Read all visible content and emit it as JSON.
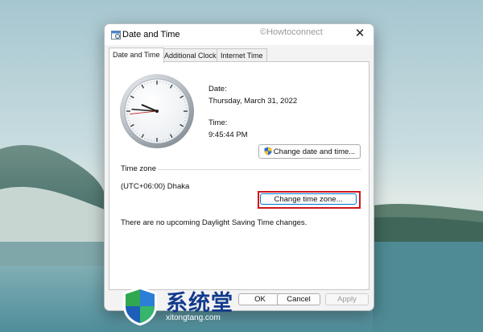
{
  "window": {
    "title": "Date and Time",
    "close_glyph": "✕",
    "watermark": "©Howtoconnect"
  },
  "tabs": [
    {
      "label": "Date and Time",
      "active": true
    },
    {
      "label": "Additional Clocks",
      "active": false
    },
    {
      "label": "Internet Time",
      "active": false
    }
  ],
  "clock": {
    "hours": 9,
    "minutes": 45,
    "seconds": 44,
    "hand_color": "#1e1e1e",
    "second_hand_color": "#c21a1a"
  },
  "date_section": {
    "date_label": "Date:",
    "date_value": "Thursday, March 31, 2022",
    "time_label": "Time:",
    "time_value": "9:45:44 PM",
    "change_button": "Change date and time..."
  },
  "timezone_section": {
    "heading": "Time zone",
    "value": "(UTC+06:00) Dhaka",
    "change_button": "Change time zone...",
    "dst_note": "There are no upcoming Daylight Saving Time changes."
  },
  "footer": {
    "ok": "OK",
    "cancel": "Cancel",
    "apply": "Apply"
  },
  "watermark_bottom": {
    "chinese_text": "系统堂",
    "url": "xitongtang.com"
  },
  "colors": {
    "highlight": "#d0161d",
    "focus": "#0078d4",
    "watermark_blue": "#123a8c"
  }
}
